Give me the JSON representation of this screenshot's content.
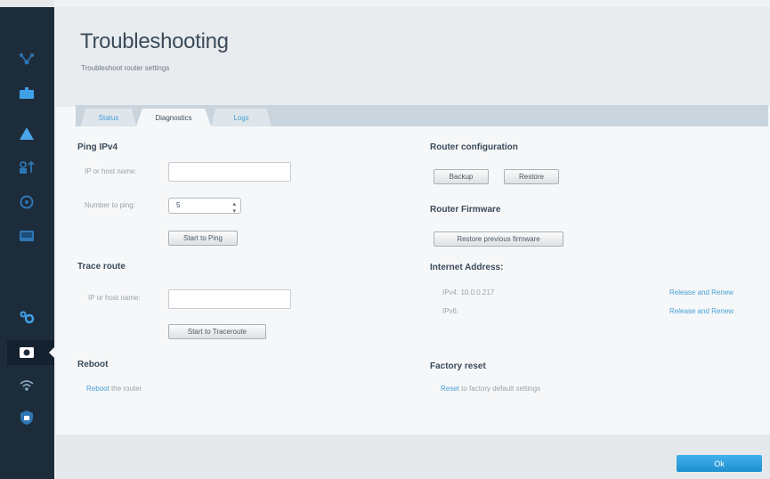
{
  "page": {
    "title": "Troubleshooting",
    "subtitle": "Troubleshoot router settings"
  },
  "tabs": [
    {
      "label": "Status",
      "active": false
    },
    {
      "label": "Diagnostics",
      "active": true
    },
    {
      "label": "Logs",
      "active": false
    }
  ],
  "ping": {
    "title": "Ping IPv4",
    "host_label": "IP or host name:",
    "host_value": "",
    "number_label": "Number to ping:",
    "number_value": "5",
    "start_button": "Start to Ping"
  },
  "trace": {
    "title": "Trace route",
    "host_label": "IP or host name:",
    "host_value": "",
    "start_button": "Start to Traceroute"
  },
  "reboot": {
    "title": "Reboot",
    "link": "Reboot",
    "text": " the router"
  },
  "router_config": {
    "title": "Router configuration",
    "backup_button": "Backup",
    "restore_button": "Restore"
  },
  "firmware": {
    "title": "Router Firmware",
    "restore_button": "Restore previous firmware"
  },
  "internet": {
    "title": "Internet Address:",
    "ipv4_label": "IPv4: 10.0.0.217",
    "ipv4_action": "Release and Renew",
    "ipv6_label": "IPv6:",
    "ipv6_action": "Release and Renew"
  },
  "factory": {
    "title": "Factory reset",
    "link": "Reset",
    "text": " to factory default settings"
  },
  "footer": {
    "ok_button": "Ok"
  },
  "sidebar_icons": [
    "network-map-icon",
    "router-icon",
    "alert-icon",
    "devices-icon",
    "speed-icon",
    "display-icon",
    "connectivity-icon",
    "troubleshooting-icon",
    "wireless-icon",
    "security-shield-icon"
  ],
  "colors": {
    "sidebar": "#1d2c3b",
    "accent": "#46a0d8",
    "ok_button": "#2a9ddd",
    "alert_icon": "#4aa6e8"
  }
}
